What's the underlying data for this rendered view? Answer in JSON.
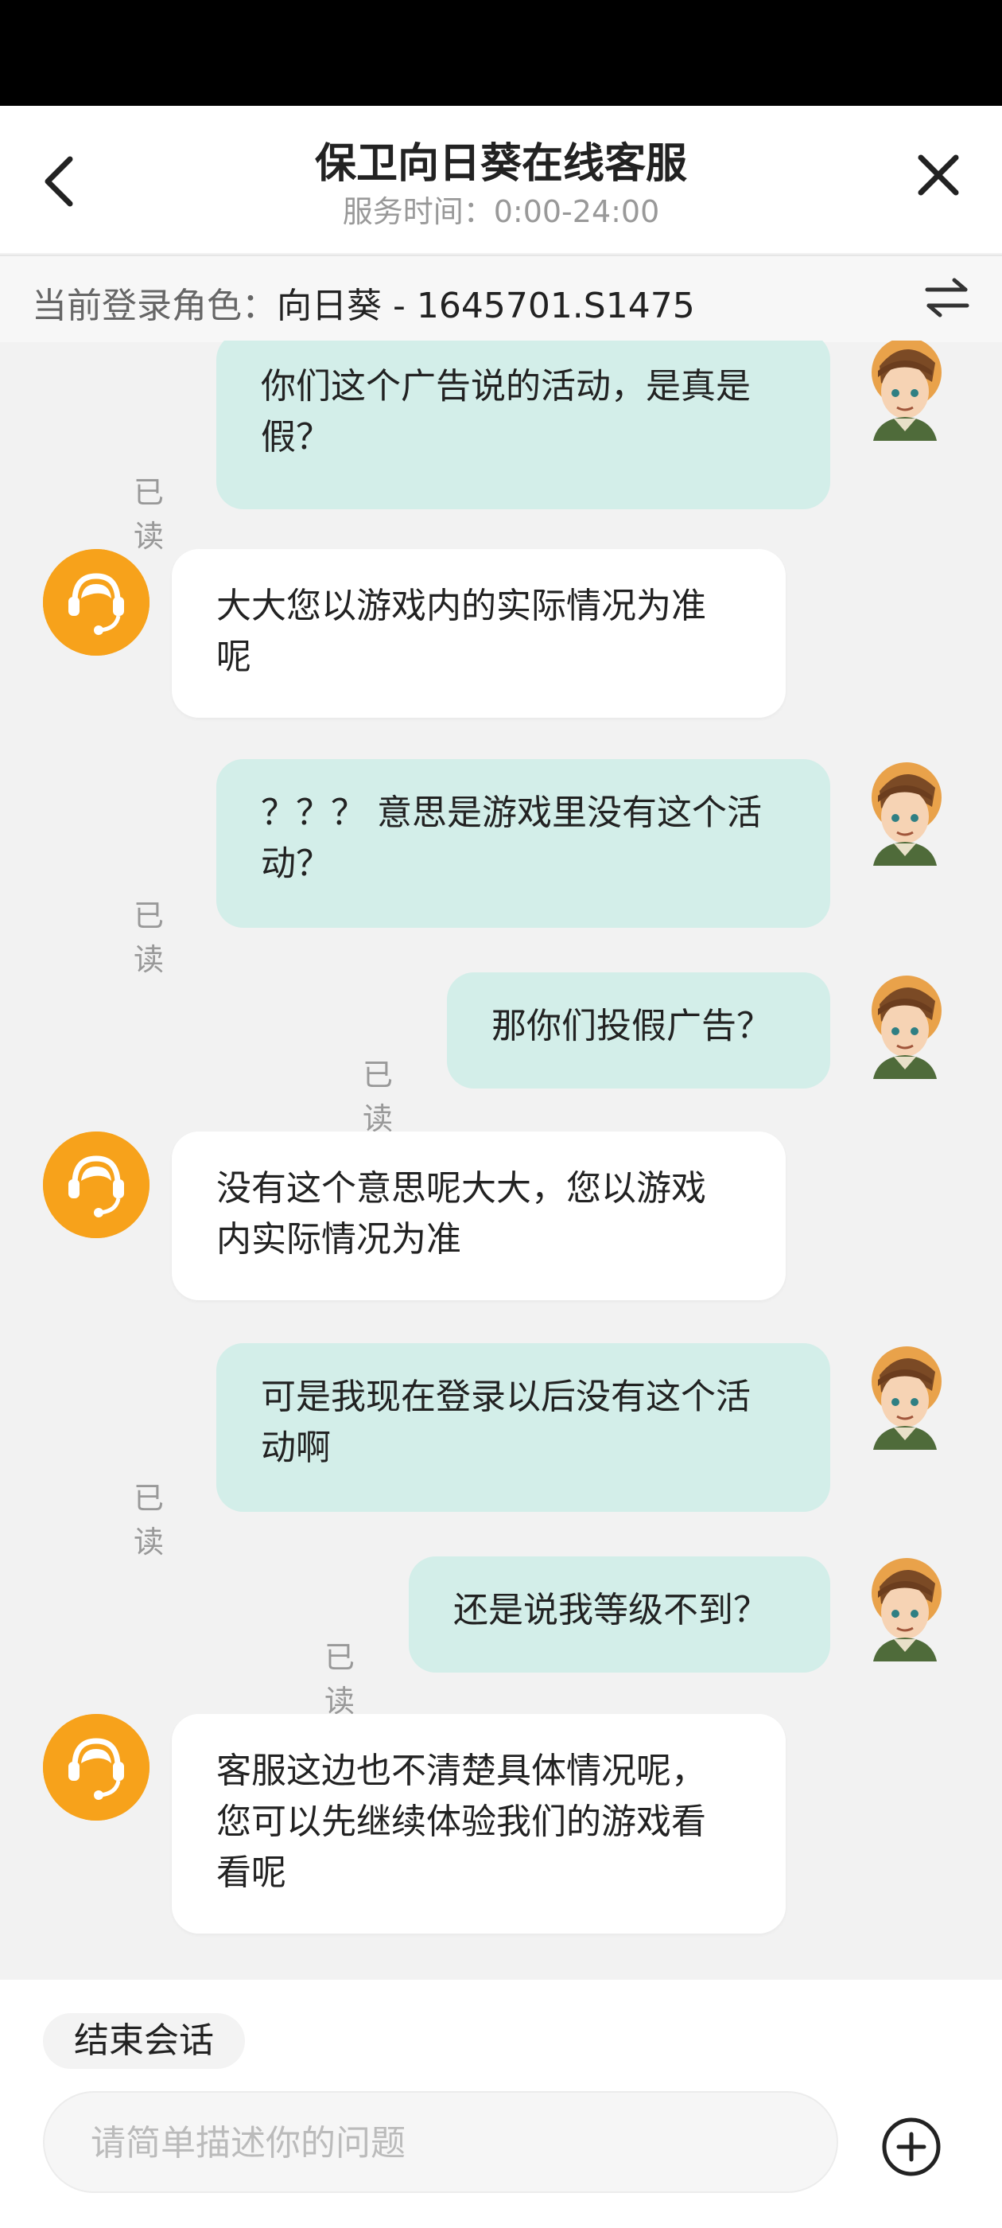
{
  "header": {
    "title": "保卫向日葵在线客服",
    "subtitle": "服务时间：0:00-24:00"
  },
  "role_bar": {
    "label": "当前登录角色：",
    "value": "向日葵 - 1645701.S1475"
  },
  "read_label": "已读",
  "messages": [
    {
      "sender": "user",
      "lines": [
        "你们这个广告说的活动，是真是",
        "假？"
      ],
      "status": "已读"
    },
    {
      "sender": "agent",
      "lines": [
        "大大您以游戏内的实际情况为准",
        "呢"
      ]
    },
    {
      "sender": "user",
      "lines": [
        "？？？ 意思是游戏里没有这个活",
        "动？"
      ],
      "status": "已读"
    },
    {
      "sender": "user",
      "lines": [
        "那你们投假广告？"
      ],
      "status": "已读"
    },
    {
      "sender": "agent",
      "lines": [
        "没有这个意思呢大大，您以游戏",
        "内实际情况为准"
      ]
    },
    {
      "sender": "user",
      "lines": [
        "可是我现在登录以后没有这个活",
        "动啊"
      ],
      "status": "已读"
    },
    {
      "sender": "user",
      "lines": [
        "还是说我等级不到？"
      ],
      "status": "已读"
    },
    {
      "sender": "agent",
      "lines": [
        "客服这边也不清楚具体情况呢，",
        "您可以先继续体验我们的游戏看",
        "看呢"
      ]
    }
  ],
  "footer": {
    "end_session_label": "结束会话",
    "input_placeholder": "请简单描述你的问题",
    "input_value": ""
  },
  "colors": {
    "user_bubble": "#d3eee9",
    "agent_avatar": "#f7a21b",
    "background": "#f2f2f2"
  },
  "icons": {
    "back": "chevron-left-icon",
    "close": "close-icon",
    "swap": "swap-arrows-icon",
    "add": "plus-circle-icon",
    "agent_avatar": "headset-support-icon",
    "user_avatar": "cartoon-character-avatar"
  }
}
